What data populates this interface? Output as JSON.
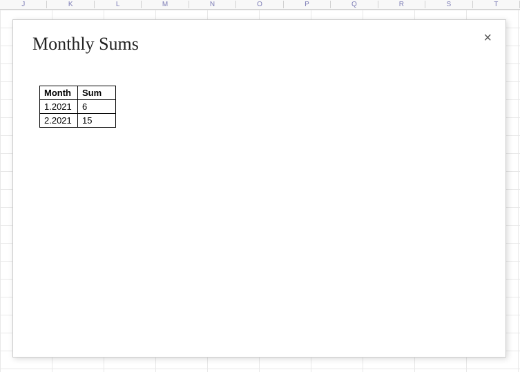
{
  "spreadsheet": {
    "columns": [
      "J",
      "K",
      "L",
      "M",
      "N",
      "O",
      "P",
      "Q",
      "R",
      "S",
      "T"
    ]
  },
  "dialog": {
    "title": "Monthly Sums",
    "close_label": "×",
    "table": {
      "headers": [
        "Month",
        "Sum"
      ],
      "rows": [
        {
          "month": "1.2021",
          "sum": "6"
        },
        {
          "month": "2.2021",
          "sum": "15"
        }
      ]
    }
  }
}
